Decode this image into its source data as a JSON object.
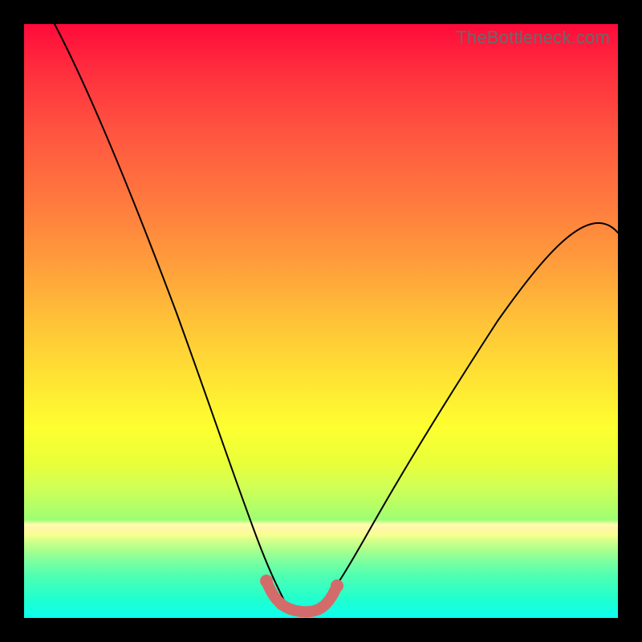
{
  "watermark": "TheBottleneck.com",
  "chart_data": {
    "type": "line",
    "title": "",
    "xlabel": "",
    "ylabel": "",
    "xlim": [
      0,
      100
    ],
    "ylim": [
      0,
      100
    ],
    "grid": false,
    "legend": false,
    "series": [
      {
        "name": "left-curve",
        "x": [
          5,
          10,
          15,
          20,
          25,
          30,
          33,
          36,
          38,
          40,
          42,
          44
        ],
        "values": [
          100,
          88,
          76,
          63,
          49,
          33,
          23,
          15,
          9,
          5,
          2,
          1
        ]
      },
      {
        "name": "right-curve",
        "x": [
          50,
          52,
          55,
          58,
          62,
          68,
          75,
          82,
          90,
          100
        ],
        "values": [
          1,
          2,
          5,
          9,
          15,
          24,
          34,
          44,
          54,
          65
        ]
      },
      {
        "name": "valley-highlight",
        "x": [
          41,
          43,
          45,
          47,
          49,
          51
        ],
        "values": [
          4,
          1,
          0.5,
          0.5,
          1,
          4
        ]
      }
    ],
    "background_gradient": {
      "top": "#ff0a3a",
      "mid": "#fdff30",
      "band": "#ffffb0",
      "bottom": "#0dfff0"
    },
    "highlight_color": "#d46b6b"
  }
}
